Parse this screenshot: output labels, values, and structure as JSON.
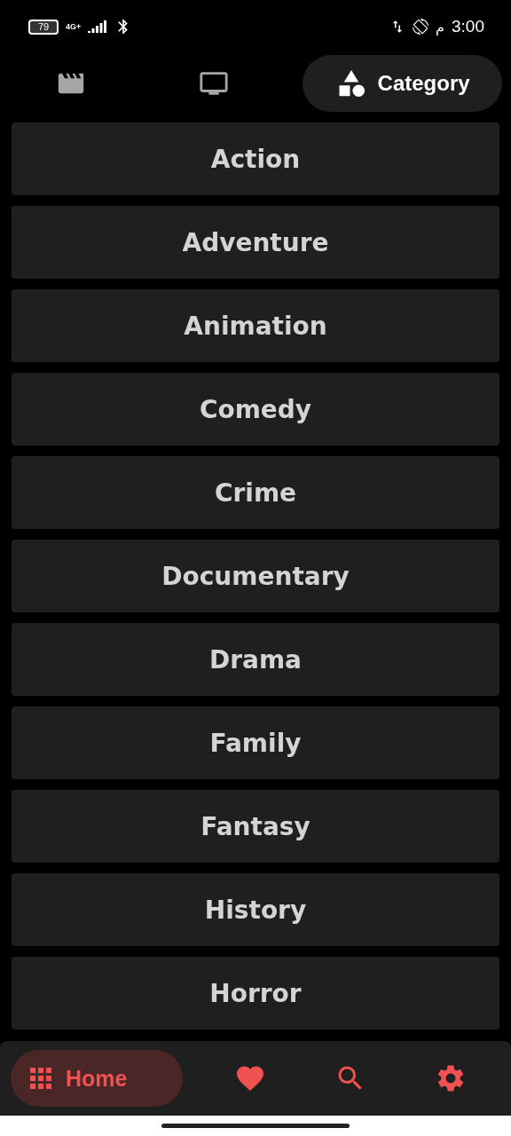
{
  "status_bar": {
    "battery": "79",
    "network": "4G+",
    "period": "م",
    "time": "3:00"
  },
  "tabs": [
    {
      "selected": false
    },
    {
      "selected": false
    },
    {
      "label": "Category",
      "selected": true
    }
  ],
  "categories": [
    "Action",
    "Adventure",
    "Animation",
    "Comedy",
    "Crime",
    "Documentary",
    "Drama",
    "Family",
    "Fantasy",
    "History",
    "Horror"
  ],
  "bottom_nav": [
    {
      "label": "Home",
      "selected": true
    },
    {
      "selected": false
    },
    {
      "selected": false
    },
    {
      "selected": false
    }
  ]
}
